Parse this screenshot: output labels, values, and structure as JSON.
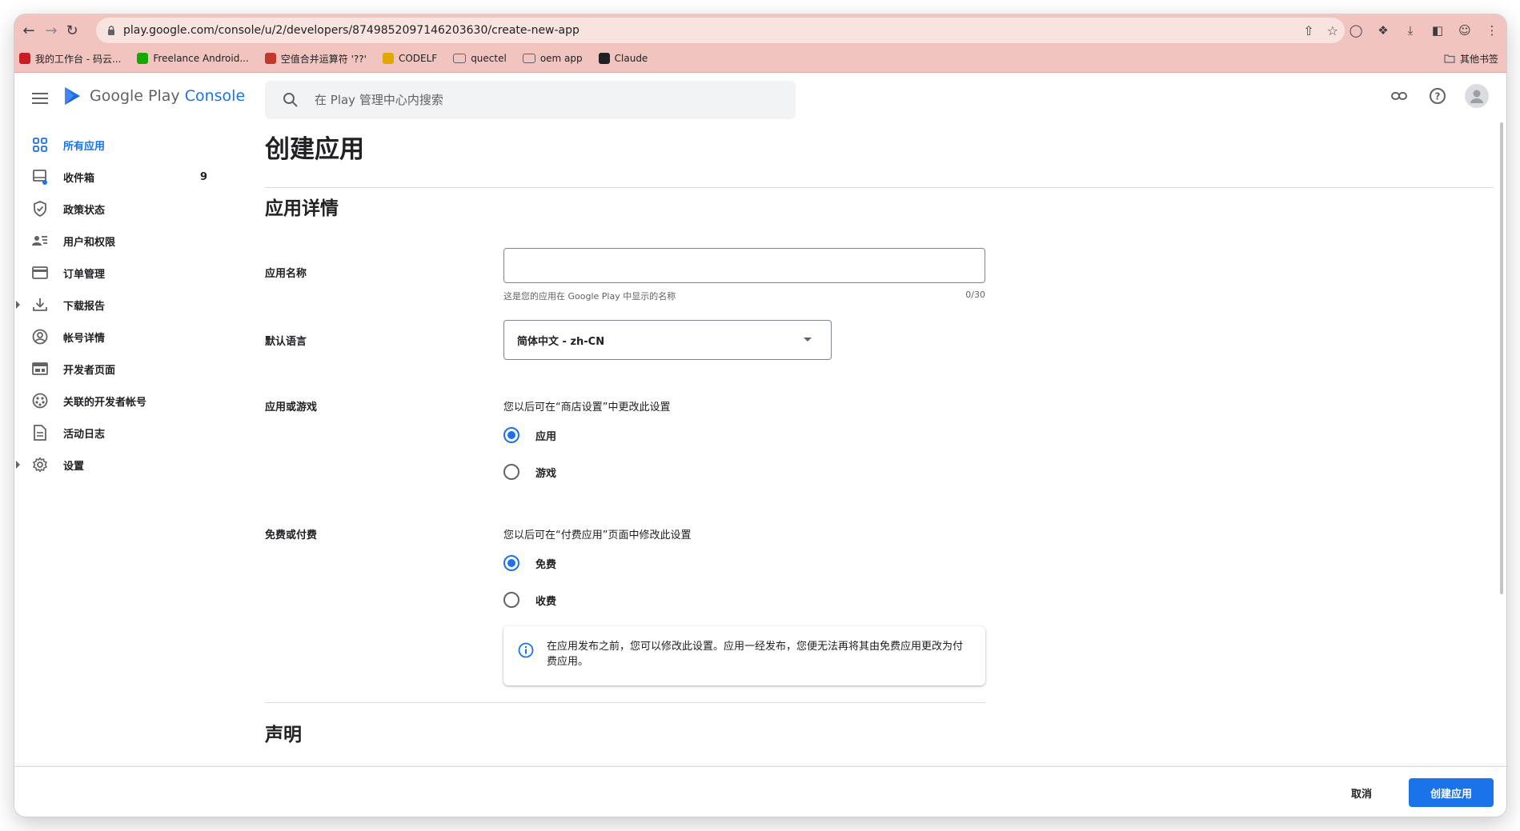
{
  "browser": {
    "url": "play.google.com/console/u/2/developers/8749852097146203630/create-new-app",
    "bookmarks": [
      {
        "label": "我的工作台 - 码云...",
        "icon": "gitee-icon",
        "color": "#c71d23"
      },
      {
        "label": "Freelance Android...",
        "icon": "upwork-icon",
        "color": "#14a800"
      },
      {
        "label": "空值合并运算符 '??'",
        "icon": "mdn-icon",
        "color": "#c0392b"
      },
      {
        "label": "CODELF",
        "icon": "codelf-icon",
        "color": "#e0a800"
      },
      {
        "label": "quectel",
        "icon": "folder-icon",
        "color": "#5f6368"
      },
      {
        "label": "oem app",
        "icon": "folder-icon",
        "color": "#5f6368"
      },
      {
        "label": "Claude",
        "icon": "anthropic-icon",
        "color": "#202124"
      }
    ],
    "other_bookmarks": "其他书签"
  },
  "header": {
    "logo_text": "Google Play",
    "logo_console": "Console",
    "search_placeholder": "在 Play 管理中心内搜索"
  },
  "sidebar": {
    "items": [
      {
        "label": "所有应用",
        "icon": "apps-grid-icon",
        "active": true
      },
      {
        "label": "收件箱",
        "icon": "inbox-icon",
        "badge": "9"
      },
      {
        "label": "政策状态",
        "icon": "policy-shield-icon"
      },
      {
        "label": "用户和权限",
        "icon": "users-icon"
      },
      {
        "label": "订单管理",
        "icon": "credit-card-icon"
      },
      {
        "label": "下载报告",
        "icon": "download-icon",
        "expandable": true
      },
      {
        "label": "帐号详情",
        "icon": "account-icon"
      },
      {
        "label": "开发者页面",
        "icon": "web-page-icon"
      },
      {
        "label": "关联的开发者帐号",
        "icon": "linked-accounts-icon"
      },
      {
        "label": "活动日志",
        "icon": "document-icon"
      },
      {
        "label": "设置",
        "icon": "gear-icon",
        "expandable": true
      }
    ]
  },
  "main": {
    "page_title": "创建应用",
    "app_details": {
      "section_title": "应用详情",
      "app_name_label": "应用名称",
      "app_name_value": "",
      "app_name_hint": "这是您的应用在 Google Play 中显示的名称",
      "app_name_count": "0/30",
      "default_language_label": "默认语言",
      "default_language_value": "简体中文 - zh-CN",
      "app_or_game_label": "应用或游戏",
      "app_or_game_note": "您以后可在“商店设置”中更改此设置",
      "app_or_game_options": [
        {
          "label": "应用",
          "checked": true
        },
        {
          "label": "游戏",
          "checked": false
        }
      ],
      "free_or_paid_label": "免费或付费",
      "free_or_paid_note": "您以后可在“付费应用”页面中修改此设置",
      "free_or_paid_options": [
        {
          "label": "免费",
          "checked": true
        },
        {
          "label": "收费",
          "checked": false
        }
      ],
      "info_text": "在应用发布之前，您可以修改此设置。应用一经发布，您便无法再将其由免费应用更改为付费应用。"
    },
    "declarations_title": "声明"
  },
  "footer": {
    "cancel_label": "取消",
    "create_label": "创建应用"
  },
  "colors": {
    "accent": "#1a73e8",
    "chrome": "#f1c4bf"
  }
}
